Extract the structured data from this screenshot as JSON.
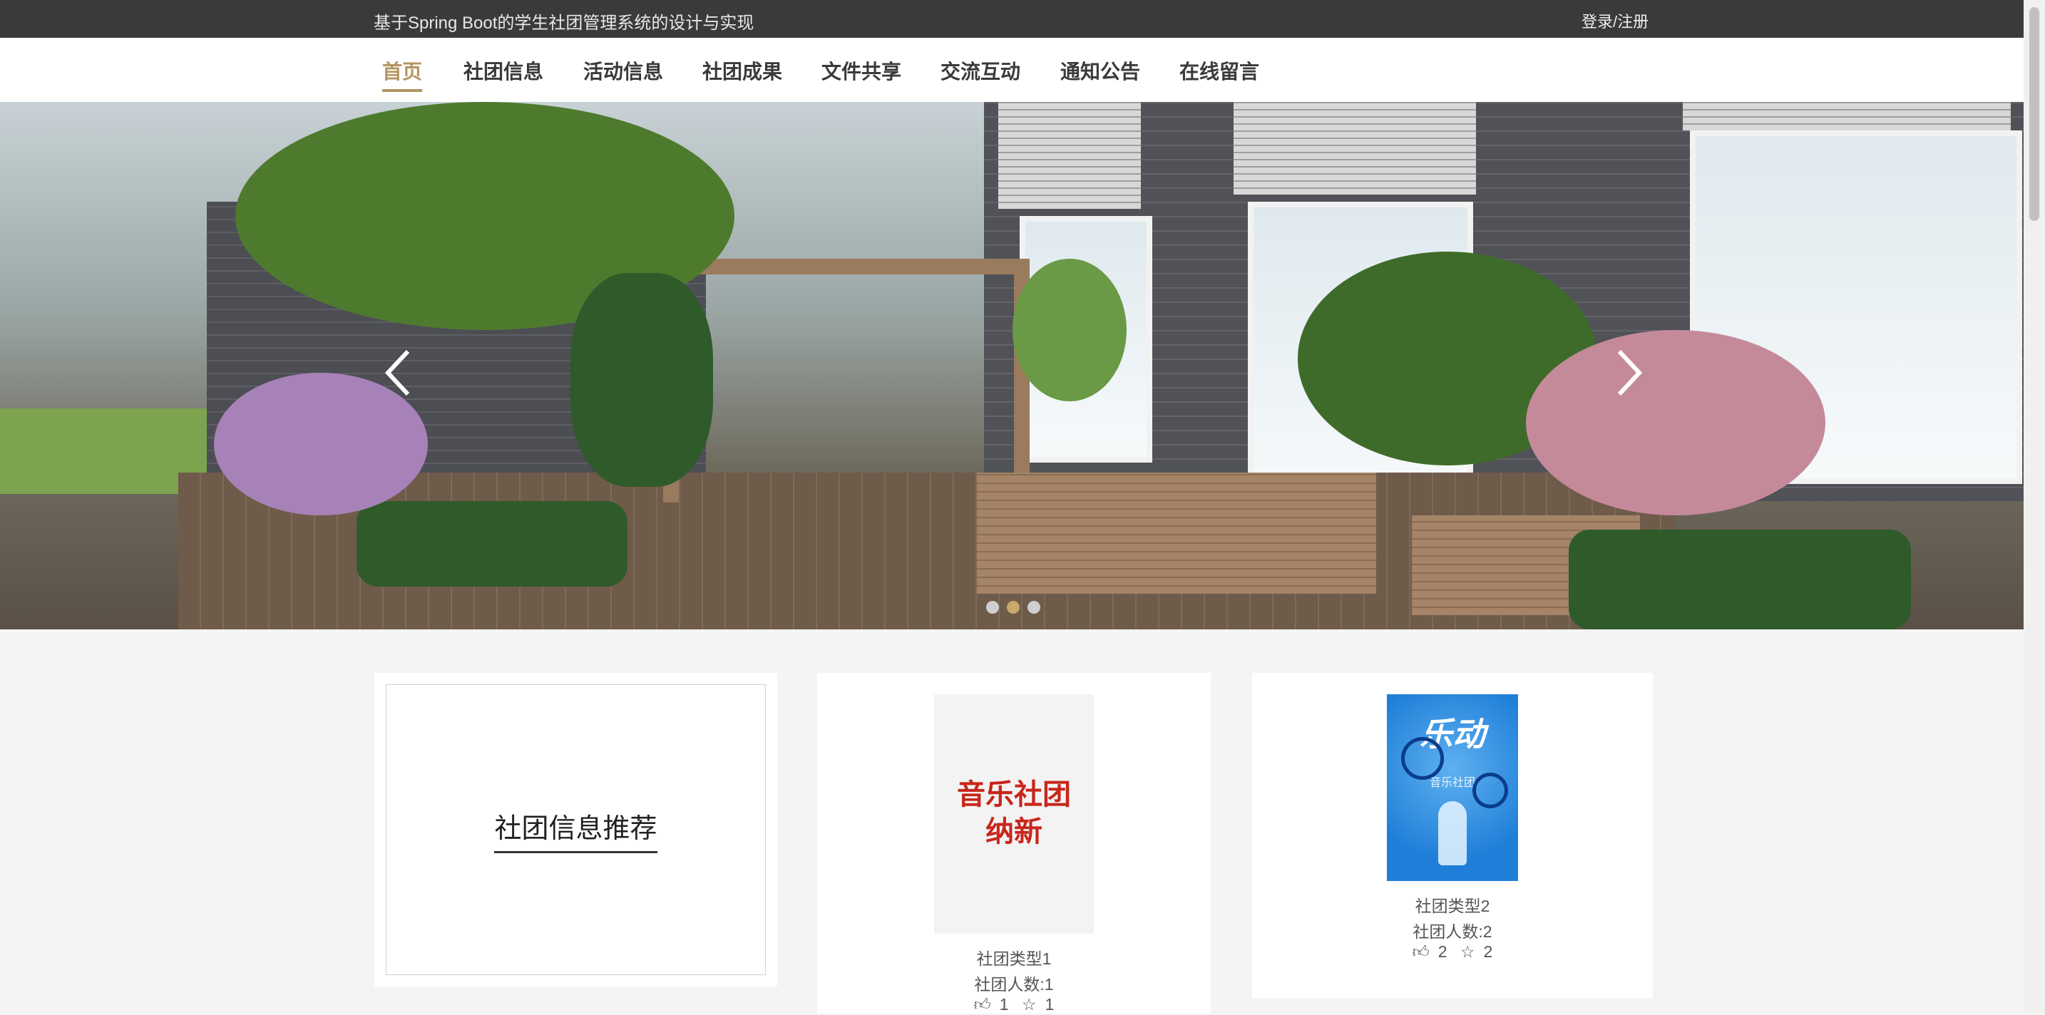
{
  "topbar": {
    "title": "基于Spring Boot的学生社团管理系统的设计与实现",
    "login": "登录/注册"
  },
  "nav": {
    "items": [
      {
        "label": "首页",
        "active": true
      },
      {
        "label": "社团信息"
      },
      {
        "label": "活动信息"
      },
      {
        "label": "社团成果"
      },
      {
        "label": "文件共享"
      },
      {
        "label": "交流互动"
      },
      {
        "label": "通知公告"
      },
      {
        "label": "在线留言"
      }
    ]
  },
  "banner": {
    "slide_count": 3,
    "active_slide": 2
  },
  "recommend": {
    "title": "社团信息推荐"
  },
  "clubs": [
    {
      "poster_text": "音乐社团纳新",
      "type": "社团类型1",
      "count": "社团人数:1",
      "likes": "1",
      "favorites": "1"
    },
    {
      "poster_text": "乐动",
      "poster_subtext": "音乐社团",
      "type": "社团类型2",
      "count": "社团人数:2",
      "likes": "2",
      "favorites": "2"
    }
  ],
  "colors": {
    "accent": "#b39563",
    "topbar": "#3a3a3a",
    "poster_red": "#c8261b",
    "poster_blue": "#1f7fd8"
  }
}
